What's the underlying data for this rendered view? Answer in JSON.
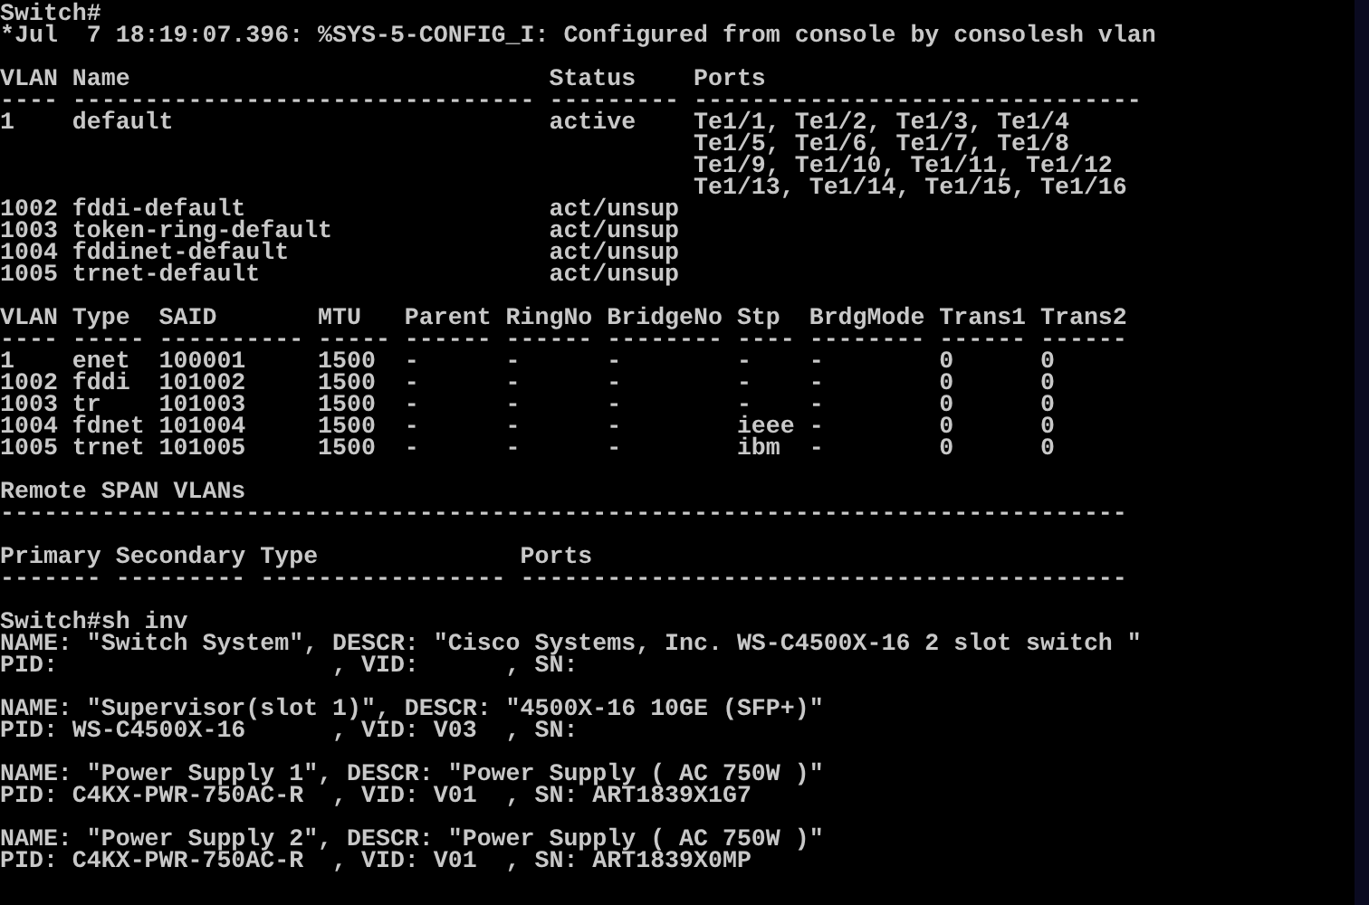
{
  "terminal": {
    "blocks": [
      {
        "lines": [
          "Switch#",
          "*Jul  7 18:19:07.396: %SYS-5-CONFIG_I: Configured from console by consolesh vlan"
        ]
      },
      {
        "heading": [
          "VLAN Name                             Status    Ports",
          "---- -------------------------------- --------- -------------------------------"
        ],
        "lines": [
          "1    default                          active    Te1/1, Te1/2, Te1/3, Te1/4",
          "                                                Te1/5, Te1/6, Te1/7, Te1/8",
          "                                                Te1/9, Te1/10, Te1/11, Te1/12",
          "                                                Te1/13, Te1/14, Te1/15, Te1/16",
          "1002 fddi-default                     act/unsup",
          "1003 token-ring-default               act/unsup",
          "1004 fddinet-default                  act/unsup",
          "1005 trnet-default                    act/unsup"
        ]
      },
      {
        "heading": [
          "VLAN Type  SAID       MTU   Parent RingNo BridgeNo Stp  BrdgMode Trans1 Trans2",
          "---- ----- ---------- ----- ------ ------ -------- ---- -------- ------ ------"
        ],
        "lines": [
          "1    enet  100001     1500  -      -      -        -    -        0      0",
          "1002 fddi  101002     1500  -      -      -        -    -        0      0",
          "1003 tr    101003     1500  -      -      -        -    -        0      0",
          "1004 fdnet 101004     1500  -      -      -        ieee -        0      0",
          "1005 trnet 101005     1500  -      -      -        ibm  -        0      0"
        ]
      },
      {
        "heading": [
          "Remote SPAN VLANs",
          "------------------------------------------------------------------------------"
        ]
      },
      {
        "heading": [
          "Primary Secondary Type              Ports",
          "------- --------- ----------------- ------------------------------------------"
        ]
      },
      {
        "lines": [
          "Switch#sh inv",
          "NAME: \"Switch System\", DESCR: \"Cisco Systems, Inc. WS-C4500X-16 2 slot switch \"",
          "PID:                   , VID:      , SN:"
        ]
      },
      {
        "lines": [
          "NAME: \"Supervisor(slot 1)\", DESCR: \"4500X-16 10GE (SFP+)\"",
          "PID: WS-C4500X-16      , VID: V03  , SN:"
        ]
      },
      {
        "lines": [
          "NAME: \"Power Supply 1\", DESCR: \"Power Supply ( AC 750W )\"",
          "PID: C4KX-PWR-750AC-R  , VID: V01  , SN: ART1839X1G7"
        ]
      },
      {
        "lines": [
          "NAME: \"Power Supply 2\", DESCR: \"Power Supply ( AC 750W )\"",
          "PID: C4KX-PWR-750AC-R  , VID: V01  , SN: ART1839X0MP"
        ]
      }
    ]
  }
}
